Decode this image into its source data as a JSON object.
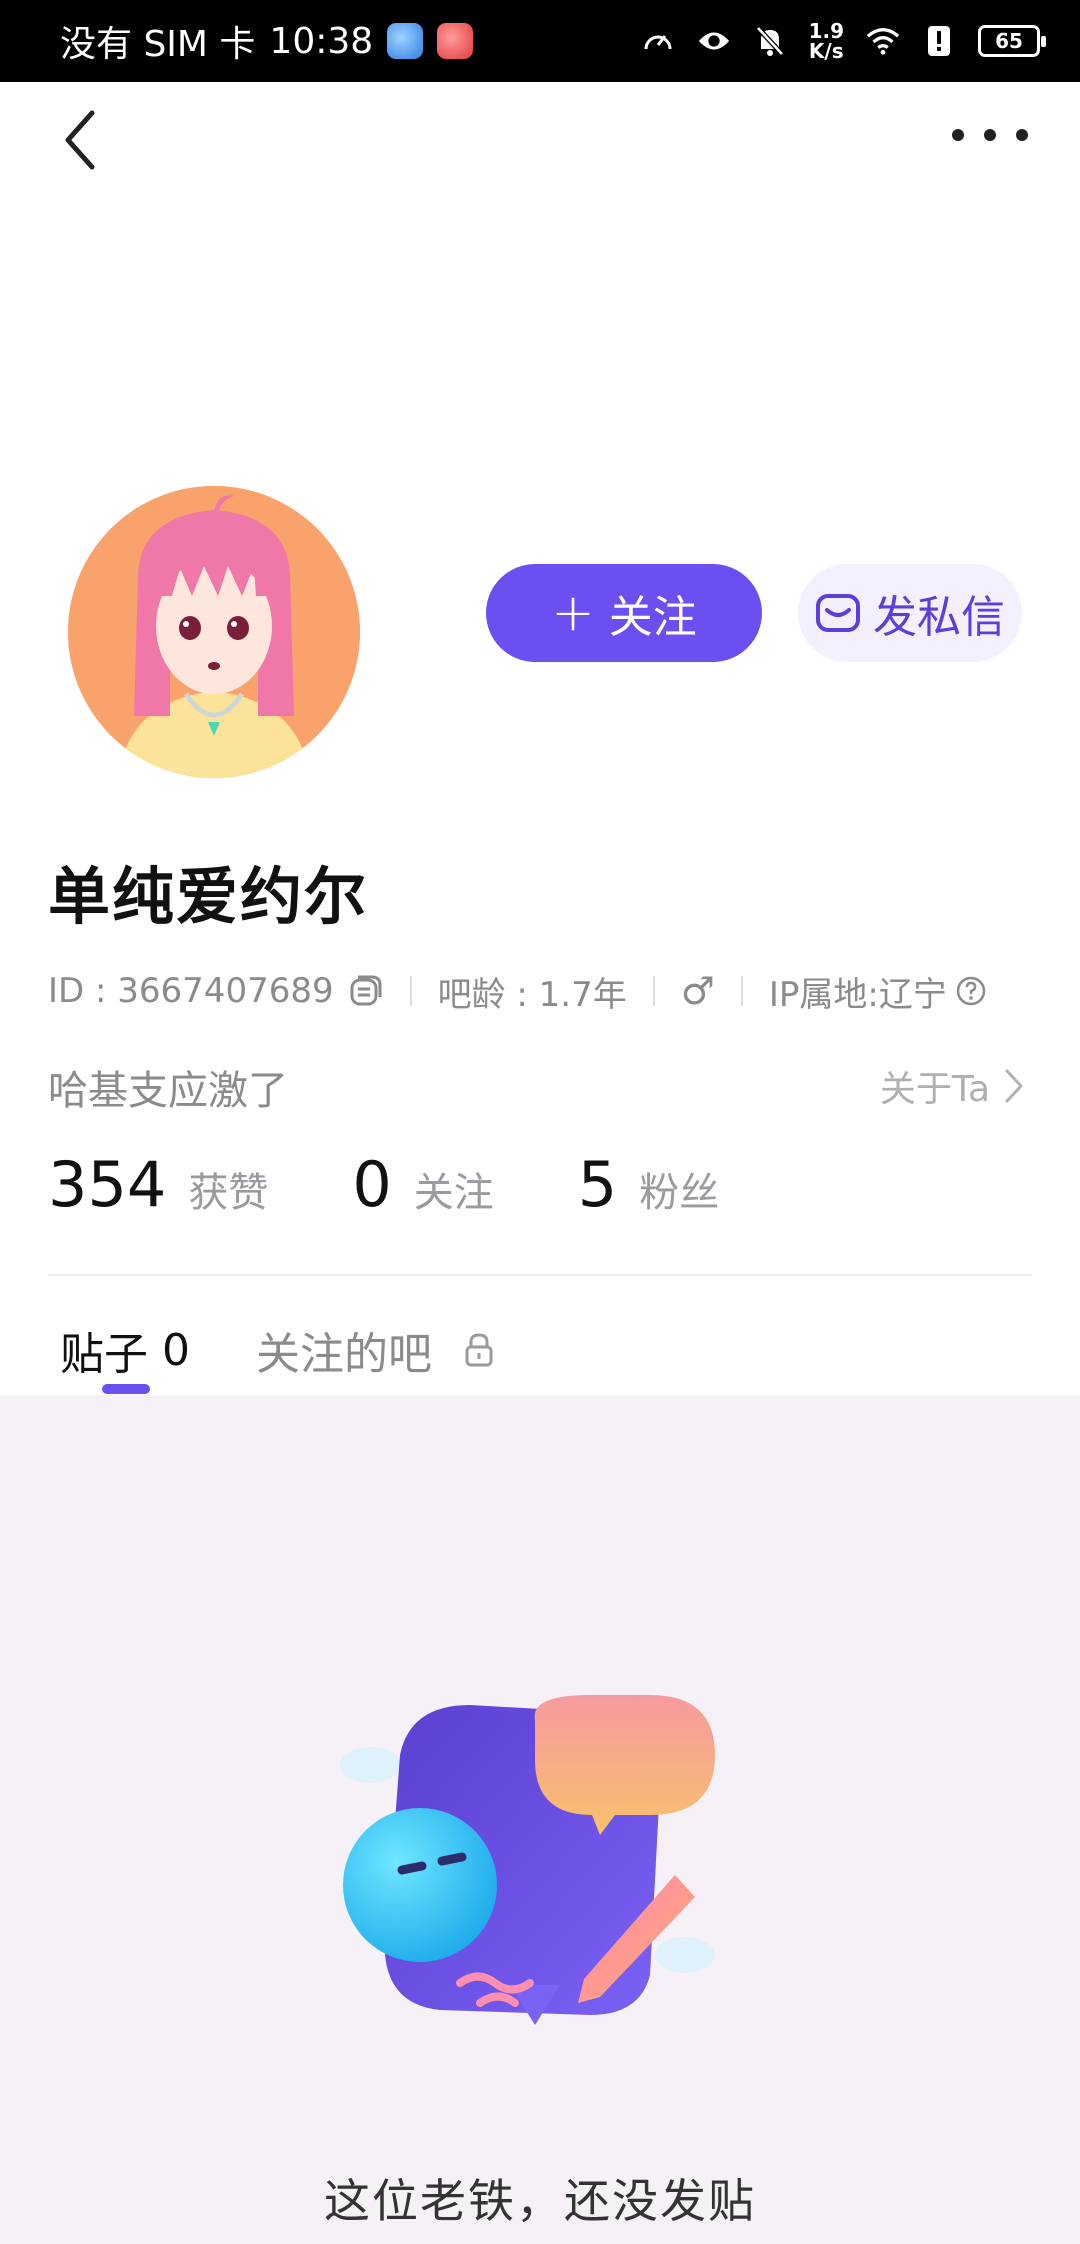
{
  "status_bar": {
    "carrier": "没有 SIM 卡",
    "time": "10:38",
    "net_speed_value": "1.9",
    "net_speed_unit": "K/s",
    "battery": "65",
    "icons": [
      "browser-app-icon",
      "red-app-icon",
      "speedometer-icon",
      "eye-icon",
      "bell-off-icon",
      "wifi-icon",
      "alert-icon",
      "battery-icon"
    ]
  },
  "nav": {
    "back_icon": "chevron-left-icon",
    "more_icon": "more-dots-icon"
  },
  "profile": {
    "follow_label": "关注",
    "follow_plus": "+",
    "message_label": "发私信",
    "username": "单纯爱约尔",
    "id_text": "ID : 3667407689",
    "bar_age": "吧龄 : 1.7年",
    "gender_symbol": "♂",
    "ip_location": "IP属地:辽宁",
    "bio": "哈基支应激了",
    "about_label": "关于Ta"
  },
  "stats": [
    {
      "num": "354",
      "label": "获赞"
    },
    {
      "num": "0",
      "label": "关注"
    },
    {
      "num": "5",
      "label": "粉丝"
    }
  ],
  "tabs": {
    "posts_label": "贴子",
    "posts_count": "0",
    "followed_bars_label": "关注的吧"
  },
  "empty_state": {
    "text": "这位老铁，还没发贴"
  },
  "colors": {
    "accent": "#6b4ff0",
    "avatar_bg": "#f9a26b",
    "content_bg": "#f6f1f6"
  }
}
